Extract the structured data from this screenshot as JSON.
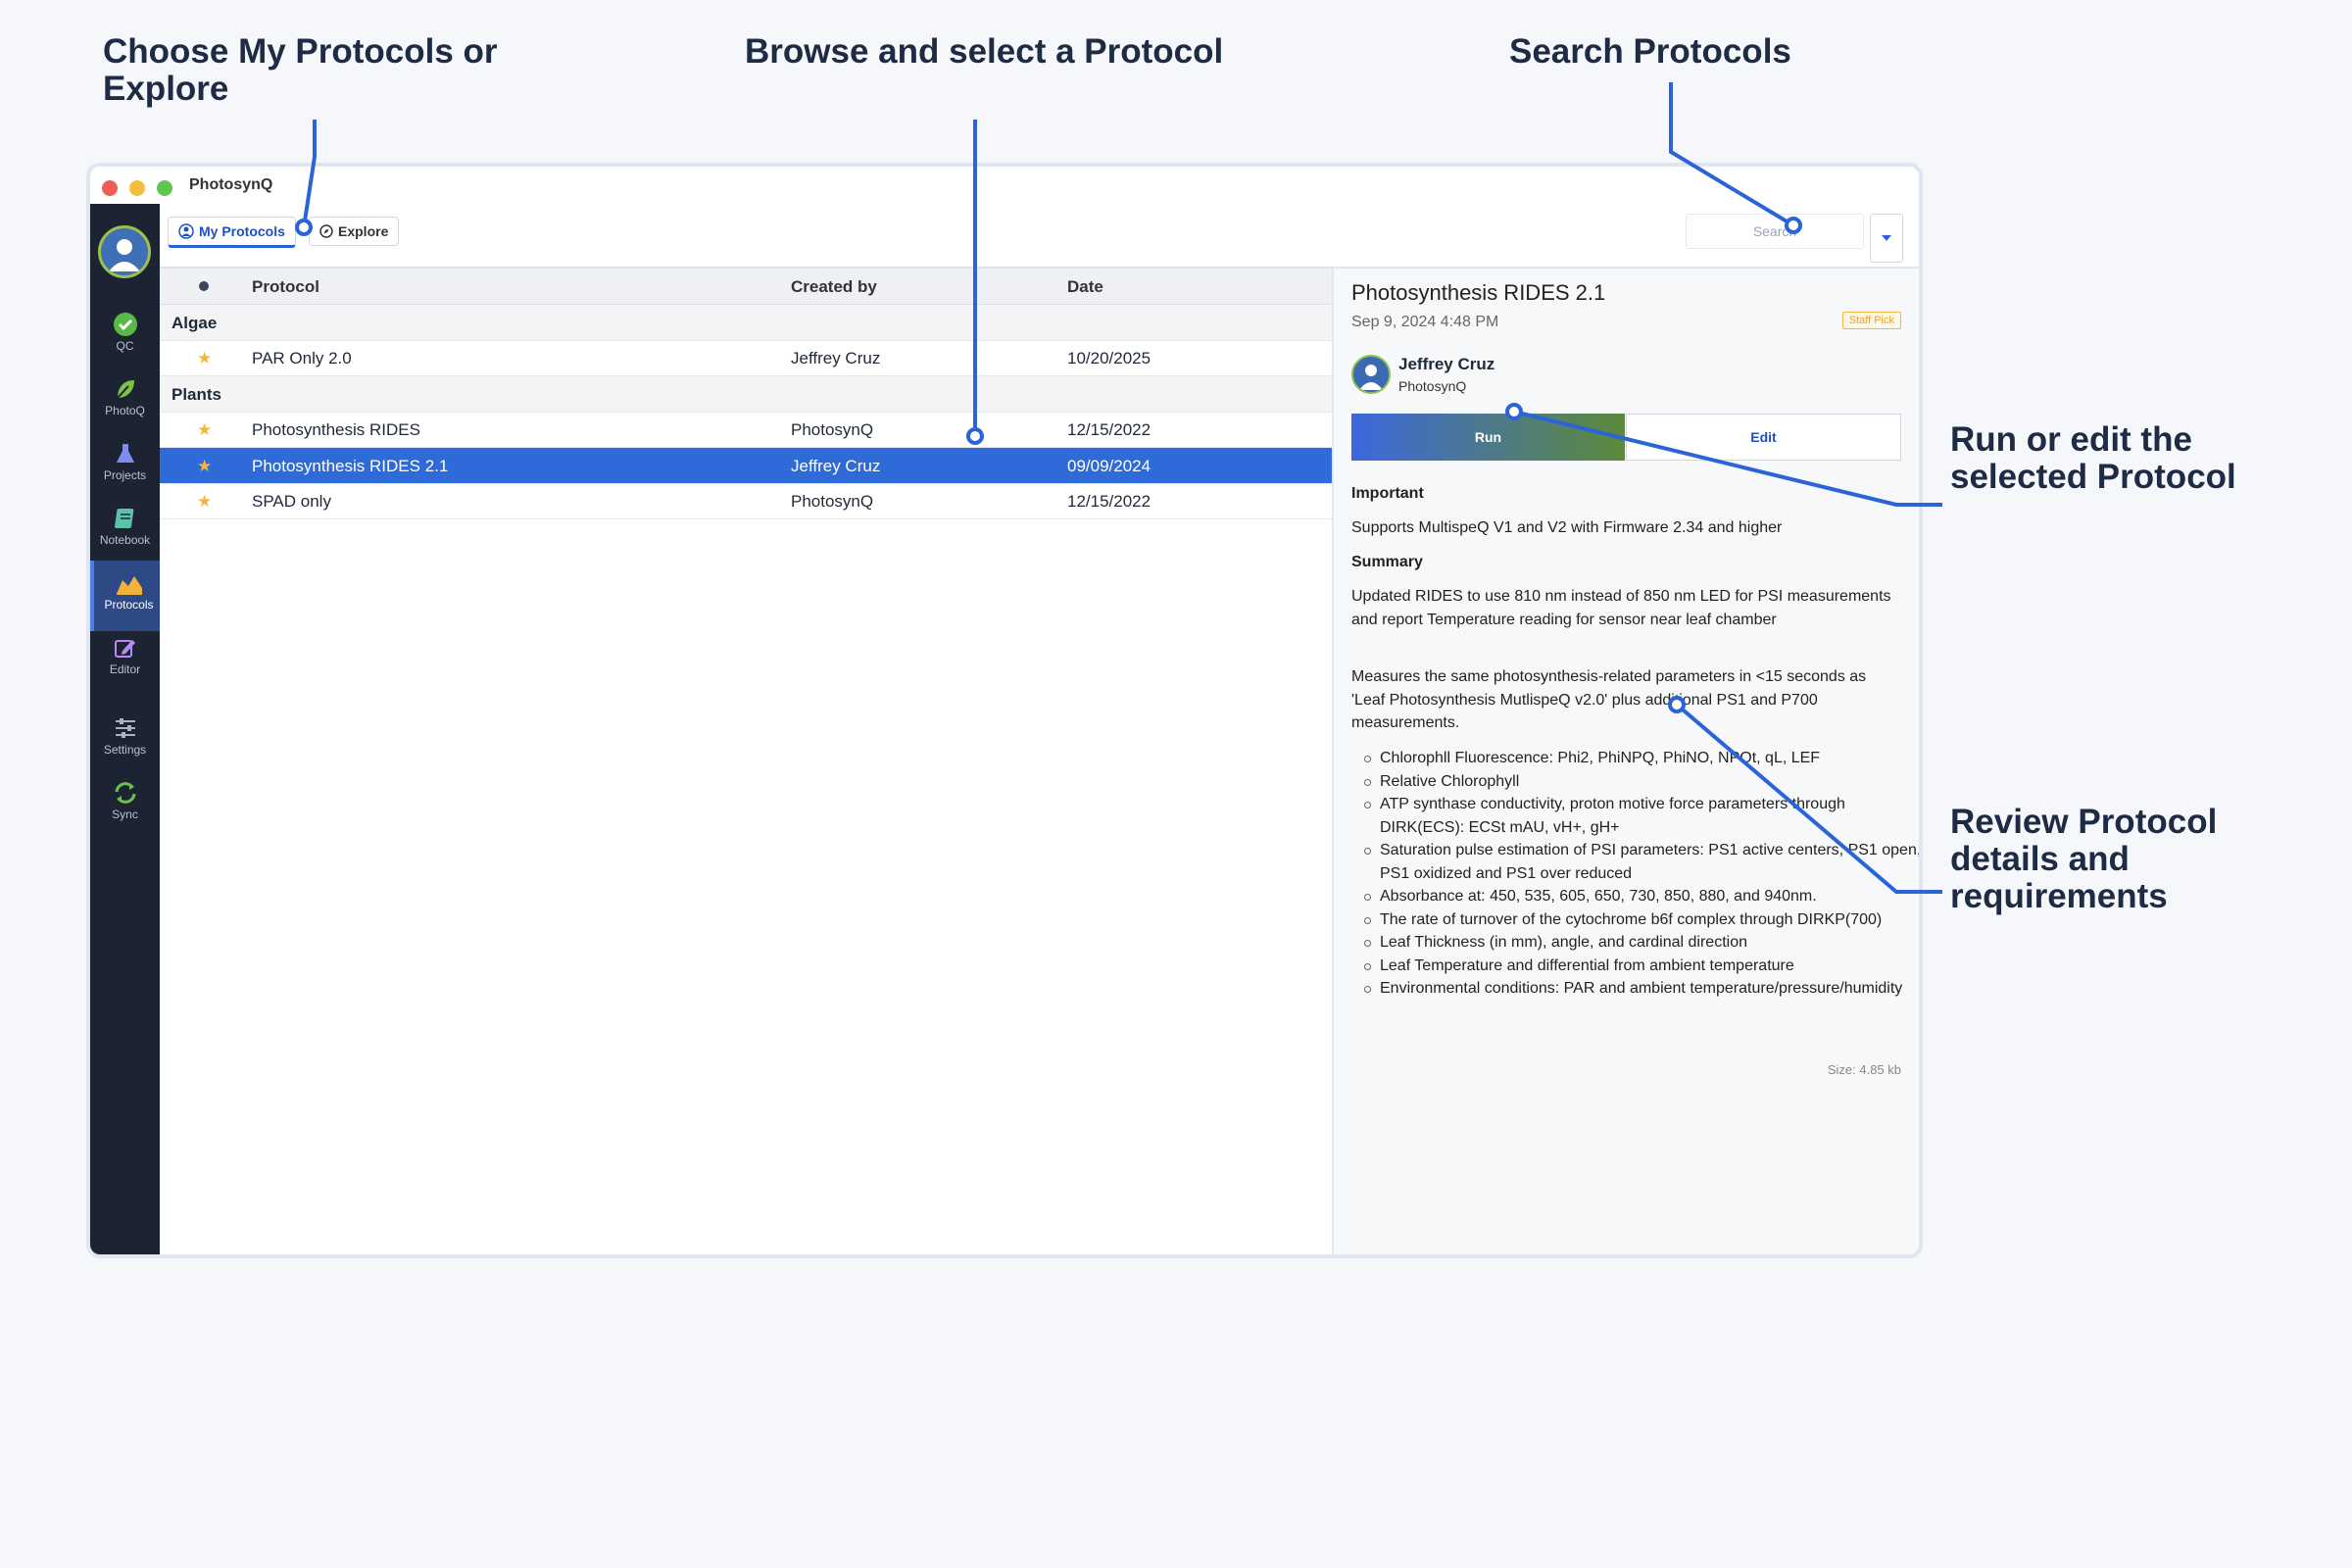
{
  "callouts": {
    "choose": "Choose My Protocols or Explore",
    "browse": "Browse and select a Protocol",
    "search": "Search Protocols",
    "run_edit": "Run or edit the selected Protocol",
    "review": "Review Protocol details and requirements"
  },
  "window": {
    "title": "PhotosynQ"
  },
  "sidebar": {
    "items": [
      {
        "label": "QC",
        "icon": "check-circle-icon"
      },
      {
        "label": "PhotoQ",
        "icon": "leaf-icon"
      },
      {
        "label": "Projects",
        "icon": "flask-icon"
      },
      {
        "label": "Notebook",
        "icon": "notebook-icon"
      },
      {
        "label": "Protocols",
        "icon": "chart-area-icon"
      },
      {
        "label": "Editor",
        "icon": "pencil-square-icon"
      },
      {
        "label": "Settings",
        "icon": "sliders-icon"
      },
      {
        "label": "Sync",
        "icon": "sync-icon"
      }
    ]
  },
  "toolbar": {
    "tab_my": "My Protocols",
    "tab_explore": "Explore",
    "search_placeholder": "Search"
  },
  "table": {
    "columns": [
      "Protocol",
      "Created by",
      "Date"
    ],
    "groups": [
      {
        "name": "Algae",
        "rows": [
          {
            "protocol": "PAR Only 2.0",
            "created_by": "Jeffrey Cruz",
            "date": "10/20/2025"
          }
        ]
      },
      {
        "name": "Plants",
        "rows": [
          {
            "protocol": "Photosynthesis RIDES",
            "created_by": "PhotosynQ",
            "date": "12/15/2022"
          },
          {
            "protocol": "Photosynthesis RIDES 2.1",
            "created_by": "Jeffrey Cruz",
            "date": "09/09/2024"
          },
          {
            "protocol": "SPAD only",
            "created_by": "PhotosynQ",
            "date": "12/15/2022"
          }
        ]
      }
    ]
  },
  "detail": {
    "title": "Photosynthesis RIDES 2.1",
    "date": "Sep 9, 2024 4:48 PM",
    "badge": "Staff Pick",
    "author": "Jeffrey Cruz",
    "org": "PhotosynQ",
    "run_label": "Run",
    "edit_label": "Edit",
    "important_heading": "Important",
    "important_text": "Supports MultispeQ V1 and V2 with Firmware 2.34 and higher",
    "summary_heading": "Summary",
    "summary_p1": "Updated RIDES to use 810 nm instead of 850 nm LED for PSI measurements and report Temperature reading for sensor near leaf chamber",
    "summary_p2": "Measures the same photosynthesis-related parameters in <15 seconds as 'Leaf Photosynthesis MutlispeQ v2.0' plus additional PS1 and P700 measurements.",
    "features": [
      "Chlorophll Fluorescence: Phi2, PhiNPQ, PhiNO, NPQt, qL, LEF",
      "Relative Chlorophyll",
      "ATP synthase conductivity, proton motive force parameters through DIRK(ECS): ECSt mAU, vH+, gH+",
      "Saturation pulse estimation of PSI parameters: PS1 active centers, PS1 open, PS1 oxidized and PS1 over reduced",
      "Absorbance at: 450, 535, 605, 650, 730, 850, 880, and 940nm.",
      "The rate of turnover of the cytochrome b6f complex through DIRKP(700)",
      "Leaf Thickness (in mm), angle, and cardinal direction",
      "Leaf Temperature and differential from ambient temperature",
      "Environmental conditions: PAR and ambient temperature/pressure/humidity"
    ],
    "size": "Size: 4.85 kb"
  },
  "colors": {
    "accent": "#2f6bd8",
    "callout": "#1e2b45",
    "sidebar": "#1c2434",
    "leader": "#2b63d9"
  }
}
